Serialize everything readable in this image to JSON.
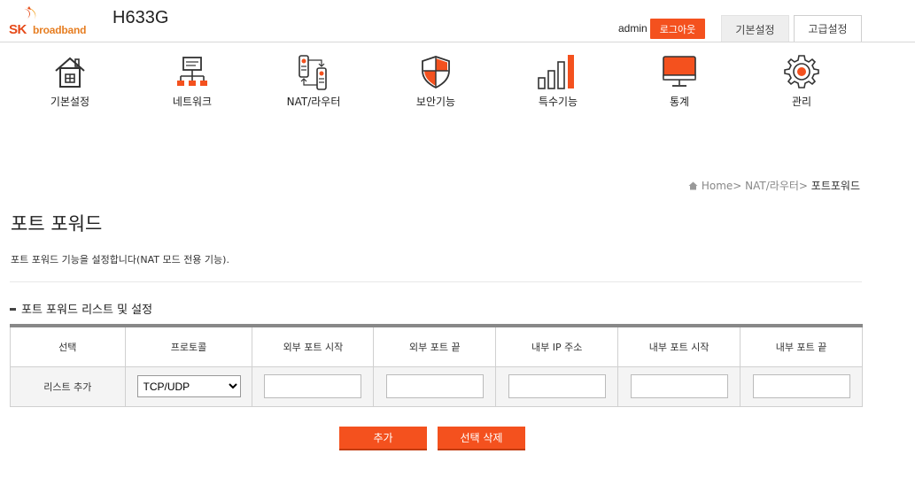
{
  "header": {
    "brand_sk": "SK",
    "brand_name": "broadband",
    "model": "H633G",
    "username": "admin",
    "logout_label": "로그아웃",
    "mode_tabs": [
      {
        "label": "기본설정",
        "active": false
      },
      {
        "label": "고급설정",
        "active": true
      }
    ]
  },
  "nav": {
    "items": [
      {
        "label": "기본설정",
        "icon": "home-icon"
      },
      {
        "label": "네트워크",
        "icon": "network-icon"
      },
      {
        "label": "NAT/라우터",
        "icon": "router-icon"
      },
      {
        "label": "보안기능",
        "icon": "shield-icon"
      },
      {
        "label": "특수기능",
        "icon": "bar-chart-icon"
      },
      {
        "label": "통계",
        "icon": "monitor-icon"
      },
      {
        "label": "관리",
        "icon": "gear-icon"
      }
    ]
  },
  "breadcrumb": {
    "home": "Home",
    "sep": ">",
    "parent": "NAT/라우터",
    "current": "포트포워드"
  },
  "page": {
    "title": "포트 포워드",
    "description": "포트 포워드 기능을 설정합니다(NAT 모드 전용 기능).",
    "section_title": "포트 포워드 리스트 및 설정"
  },
  "table": {
    "headers": [
      "선택",
      "프로토콜",
      "외부 포트 시작",
      "외부 포트 끝",
      "내부 IP 주소",
      "내부 포트 시작",
      "내부 포트 끝"
    ],
    "add_row_label": "리스트 추가",
    "protocol_selected": "TCP/UDP"
  },
  "actions": {
    "add_label": "추가",
    "delete_label": "선택 삭제"
  },
  "colors": {
    "accent": "#f4511e",
    "brand_red": "#e64a19",
    "brand_orange": "#e67e22"
  }
}
